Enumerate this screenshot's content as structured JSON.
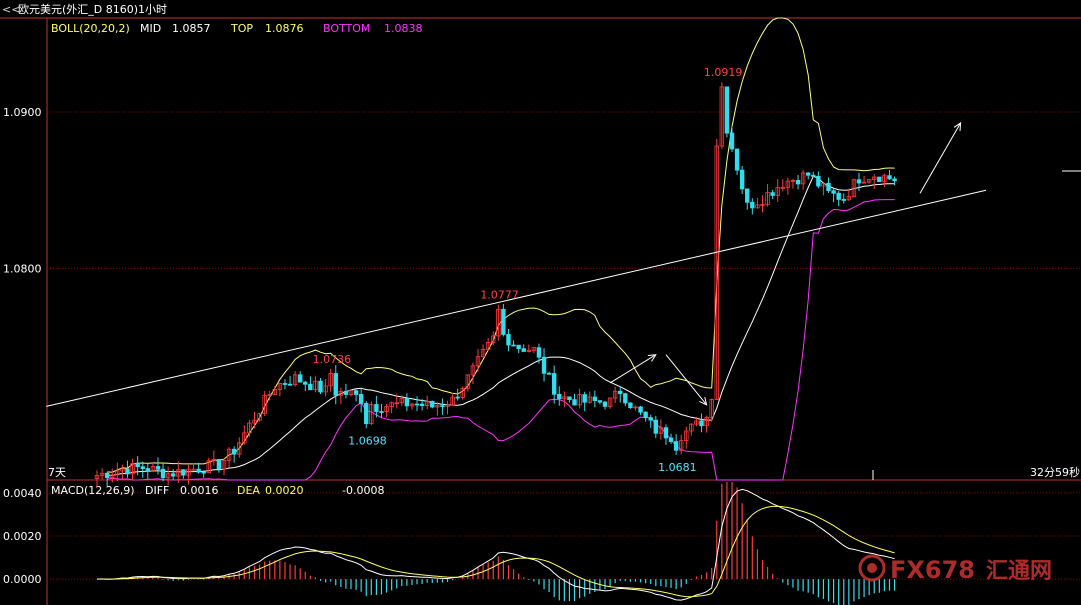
{
  "window": {
    "title_icon": "back-arrows-icon",
    "title": "欧元美元(外汇_D 8160)1小时"
  },
  "indicators": {
    "boll_name": "BOLL(20,20,2)",
    "mid_label": "MID",
    "mid_value": "1.0857",
    "top_label": "TOP",
    "top_value": "1.0876",
    "bottom_label": "BOTTOM",
    "bottom_value": "1.0838",
    "macd_name": "MACD(12,26,9)",
    "diff_label": "DIFF",
    "diff_value": "0.0016",
    "dea_label": "DEA",
    "dea_value": "0.0020",
    "macd_value": "-0.0008"
  },
  "status": {
    "left": "7天",
    "right": "32分59秒"
  },
  "watermark": {
    "brand": "FX678",
    "cn": "汇通网"
  },
  "colors": {
    "background": "#000000",
    "grid": "#8b0000",
    "up": "#ff3b3b",
    "down": "#33ddee",
    "mid": "#ffffff",
    "top": "#ffff80",
    "bottom": "#ff33ff",
    "diff": "#ffffff",
    "dea": "#ffff66",
    "label_boll": "#ffff66",
    "label_bottom": "#ff33ff"
  },
  "chart_data": {
    "type": "candlestick",
    "price_axis": {
      "ticks": [
        "1.0900",
        "1.0800"
      ],
      "range": [
        1.0665,
        1.096
      ]
    },
    "macd_axis": {
      "ticks": [
        "0.0040",
        "0.0020",
        "0.0000"
      ],
      "range": [
        -0.0012,
        0.0046
      ]
    },
    "annotations": [
      {
        "text": "1.0736",
        "kind": "high",
        "price": 1.0736,
        "bar": 46
      },
      {
        "text": "1.0777",
        "kind": "high",
        "price": 1.0777,
        "bar": 79
      },
      {
        "text": "1.0919",
        "kind": "high",
        "price": 1.0919,
        "bar": 123
      },
      {
        "text": "1.0698",
        "kind": "low",
        "price": 1.0698,
        "bar": 53
      },
      {
        "text": "1.0681",
        "kind": "low",
        "price": 1.0681,
        "bar": 114
      }
    ],
    "trendline": {
      "from": [
        -10,
        1.0712
      ],
      "to": [
        175,
        1.085
      ]
    },
    "arrows": [
      {
        "from": [
          101,
          1.0727
        ],
        "to": [
          110,
          1.0745
        ]
      },
      {
        "from": [
          112,
          1.0745
        ],
        "to": [
          120,
          1.0713
        ]
      },
      {
        "from": [
          162,
          1.0848
        ],
        "to": [
          170,
          1.0893
        ]
      }
    ],
    "key_closes": [
      [
        0,
        1.0668
      ],
      [
        5,
        1.0672
      ],
      [
        9,
        1.0673
      ],
      [
        14,
        1.0669
      ],
      [
        19,
        1.0672
      ],
      [
        24,
        1.0675
      ],
      [
        27,
        1.0684
      ],
      [
        30,
        1.07
      ],
      [
        35,
        1.0725
      ],
      [
        39,
        1.073
      ],
      [
        45,
        1.0722
      ],
      [
        50,
        1.072
      ],
      [
        55,
        1.0712
      ],
      [
        62,
        1.0714
      ],
      [
        66,
        1.0712
      ],
      [
        70,
        1.0716
      ],
      [
        73,
        1.073
      ],
      [
        76,
        1.0745
      ],
      [
        79,
        1.076
      ],
      [
        83,
        1.075
      ],
      [
        86,
        1.0748
      ],
      [
        88,
        1.0735
      ],
      [
        91,
        1.0718
      ],
      [
        96,
        1.0715
      ],
      [
        101,
        1.0715
      ],
      [
        103,
        1.0722
      ],
      [
        106,
        1.071
      ],
      [
        110,
        1.0697
      ],
      [
        114,
        1.0692
      ],
      [
        118,
        1.07
      ],
      [
        120,
        1.0705
      ],
      [
        121,
        1.072
      ],
      [
        122,
        1.088
      ],
      [
        123,
        1.0915
      ],
      [
        124,
        1.089
      ],
      [
        126,
        1.0865
      ],
      [
        128,
        1.084
      ],
      [
        131,
        1.0845
      ],
      [
        135,
        1.0855
      ],
      [
        140,
        1.086
      ],
      [
        144,
        1.0848
      ],
      [
        147,
        1.0845
      ],
      [
        150,
        1.0858
      ],
      [
        153,
        1.086
      ],
      [
        157,
        1.0857
      ]
    ]
  }
}
